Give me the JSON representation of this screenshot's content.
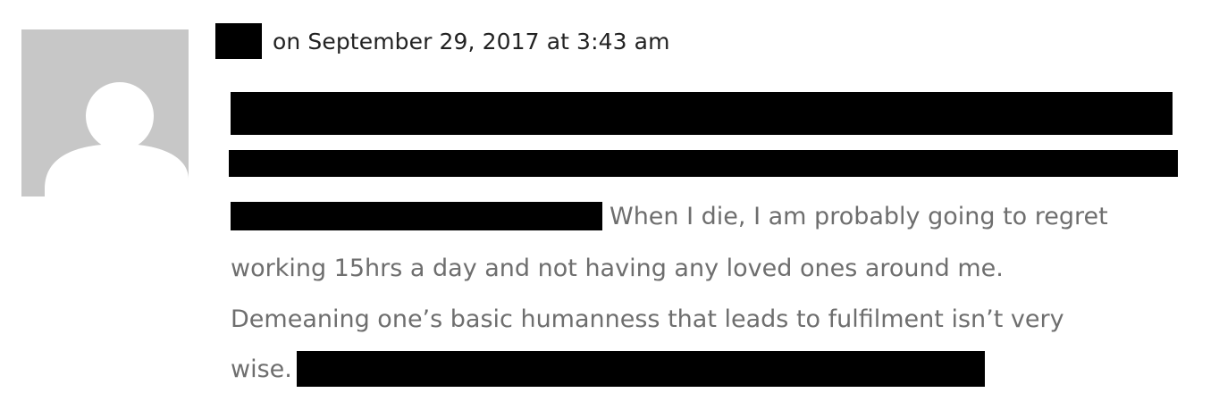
{
  "comment": {
    "author_redacted": true,
    "date_text": "on September 29, 2017 at 3:43 am",
    "avatar_icon": "default-avatar-icon",
    "text_color": "#6e6e6e",
    "body_lines": {
      "line3_tail": "When I die, I am probably going to regret",
      "line4": "working 15hrs a day and not having any loved ones around me.",
      "line5": "Demeaning one’s basic humanness that leads to fulfilment isn’t very",
      "line6_head": "wise."
    }
  },
  "colors": {
    "avatar_bg": "#c7c7c7",
    "redaction": "#000000"
  }
}
